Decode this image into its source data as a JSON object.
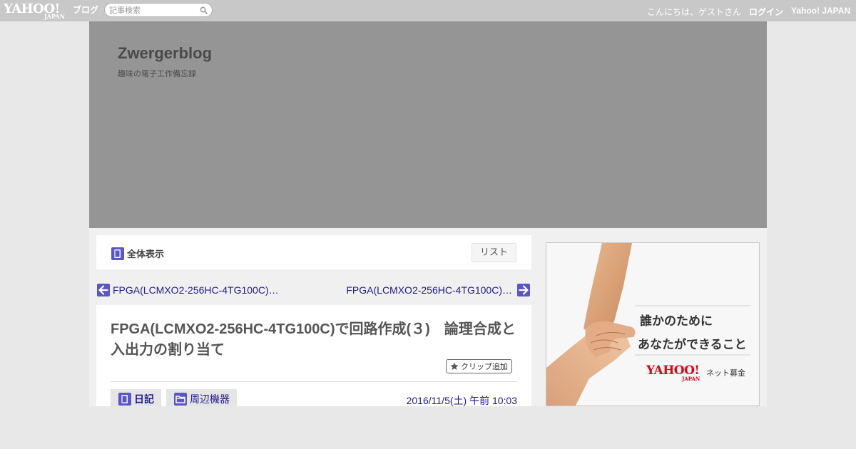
{
  "topbar": {
    "logo_text": "YAHOO!",
    "logo_sub": "JAPAN",
    "service_label": "ブログ",
    "search_placeholder": "記事検索",
    "greeting": "こんにちは、ゲストさん",
    "login_label": "ログイン",
    "yahoo_japan_label": "Yahoo! JAPAN"
  },
  "blog": {
    "title": "Zwergerblog",
    "subtitle": "趣味の電子工作備忘録"
  },
  "view_switch": {
    "all_label": "全体表示",
    "list_label": "リスト"
  },
  "nav": {
    "prev_label": "FPGA(LCMXO2-256HC-4TG100C)…",
    "next_label": "FPGA(LCMXO2-256HC-4TG100C)…"
  },
  "article": {
    "title": "FPGA(LCMXO2-256HC-4TG100C)で回路作成(３)　論理合成と入出力の割り当て",
    "clip_label": "クリップ追加",
    "tag_diary": "日記",
    "tag_category": "周辺機器",
    "date": "2016/11/5(土) 午前 10:03"
  },
  "ad": {
    "line1": "誰かのために",
    "line2": "あなたができること",
    "logo": "YAHOO!",
    "logo_sub": "JAPAN",
    "service": "ネット募金"
  },
  "colors": {
    "topbar_bg": "#c8c8c8",
    "header_bg": "#959595",
    "link": "#1f1a8c",
    "icon_blue": "#5a55c8",
    "ad_red": "#e60012"
  }
}
